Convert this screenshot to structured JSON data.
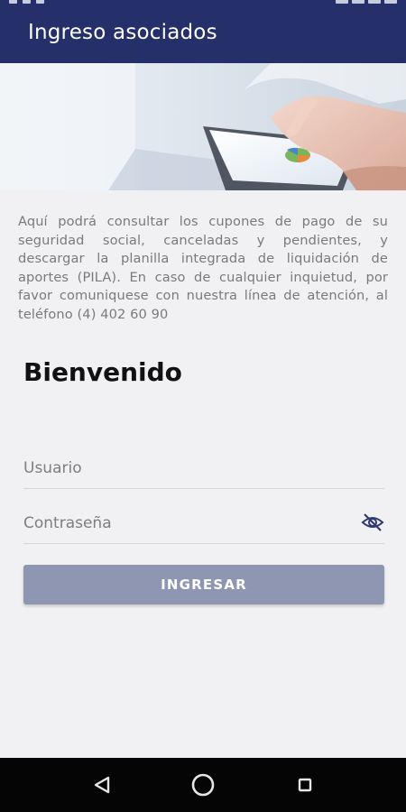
{
  "app_bar": {
    "title": "Ingreso asociados"
  },
  "intro": {
    "text": "Aquí podrá consultar los cupones de pago de su seguridad social, canceladas y pendientes, y descargar la planilla integrada de liquidación de aportes (PILA). En caso de cualquier inquietud, por favor comuniquese con nuestra línea de atención, al teléfono (4) 402 60 90"
  },
  "welcome": {
    "title": "Bienvenido"
  },
  "form": {
    "user_placeholder": "Usuario",
    "password_placeholder": "Contraseña",
    "submit_label": "INGRESAR"
  },
  "icons": {
    "visibility_toggle": "eye-off-icon",
    "nav_back": "triangle-back-icon",
    "nav_home": "circle-home-icon",
    "nav_recent": "square-recent-icon"
  },
  "colors": {
    "app_bar": "#25306b",
    "button": "#8f96b2",
    "background": "#f1f1f3",
    "nav_bar": "#050505"
  }
}
